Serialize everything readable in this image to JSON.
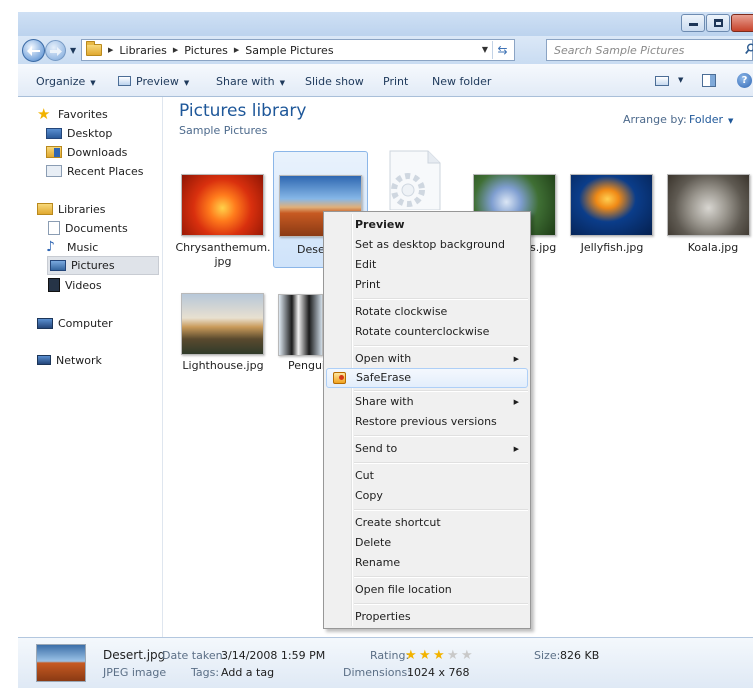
{
  "window": {
    "search_placeholder": "Search Sample Pictures"
  },
  "breadcrumb": [
    "Libraries",
    "Pictures",
    "Sample Pictures"
  ],
  "toolbar": {
    "organize": "Organize",
    "preview": "Preview",
    "share_with": "Share with",
    "slide_show": "Slide show",
    "print": "Print",
    "new_folder": "New folder"
  },
  "sidebar": {
    "favorites": "Favorites",
    "desktop": "Desktop",
    "downloads": "Downloads",
    "recent_places": "Recent Places",
    "libraries": "Libraries",
    "documents": "Documents",
    "music": "Music",
    "pictures": "Pictures",
    "videos": "Videos",
    "computer": "Computer",
    "network": "Network",
    "selected": "Pictures"
  },
  "library": {
    "title": "Pictures library",
    "subtitle": "Sample Pictures",
    "arrange_by_label": "Arrange by:",
    "arrange_by_value": "Folder"
  },
  "files": {
    "chrysanthemum_line1": "Chrysanthemum.",
    "chrysanthemum_line2": "jpg",
    "desert": "Desert.jpg",
    "desert_visible": "Deser",
    "hydrangeas_visible": "s.jpg",
    "jellyfish": "Jellyfish.jpg",
    "koala": "Koala.jpg",
    "lighthouse": "Lighthouse.jpg",
    "penguins_visible": "Pengui"
  },
  "context_menu": {
    "preview": "Preview",
    "set_desktop_background": "Set as desktop background",
    "edit": "Edit",
    "print": "Print",
    "rotate_clockwise": "Rotate clockwise",
    "rotate_counterclockwise": "Rotate counterclockwise",
    "open_with": "Open with",
    "safe_erase": "SafeErase",
    "share_with": "Share with",
    "restore_previous_versions": "Restore previous versions",
    "send_to": "Send to",
    "cut": "Cut",
    "copy": "Copy",
    "create_shortcut": "Create shortcut",
    "delete": "Delete",
    "rename": "Rename",
    "open_file_location": "Open file location",
    "properties": "Properties",
    "highlighted": "SafeErase"
  },
  "details": {
    "file_name": "Desert.jpg",
    "file_type": "JPEG image",
    "date_taken_label": "Date taken:",
    "date_taken_value": "3/14/2008 1:59 PM",
    "tags_label": "Tags:",
    "tags_value": "Add a tag",
    "rating_label": "Rating:",
    "rating_stars": 3,
    "rating_max": 5,
    "dimensions_label": "Dimensions:",
    "dimensions_value": "1024 x 768",
    "size_label": "Size:",
    "size_value": "826 KB"
  },
  "colors": {
    "accent": "#1e5799",
    "selection": "#cfe3fa",
    "menu_highlight_border": "#aecff7",
    "star": "#f2b300"
  }
}
